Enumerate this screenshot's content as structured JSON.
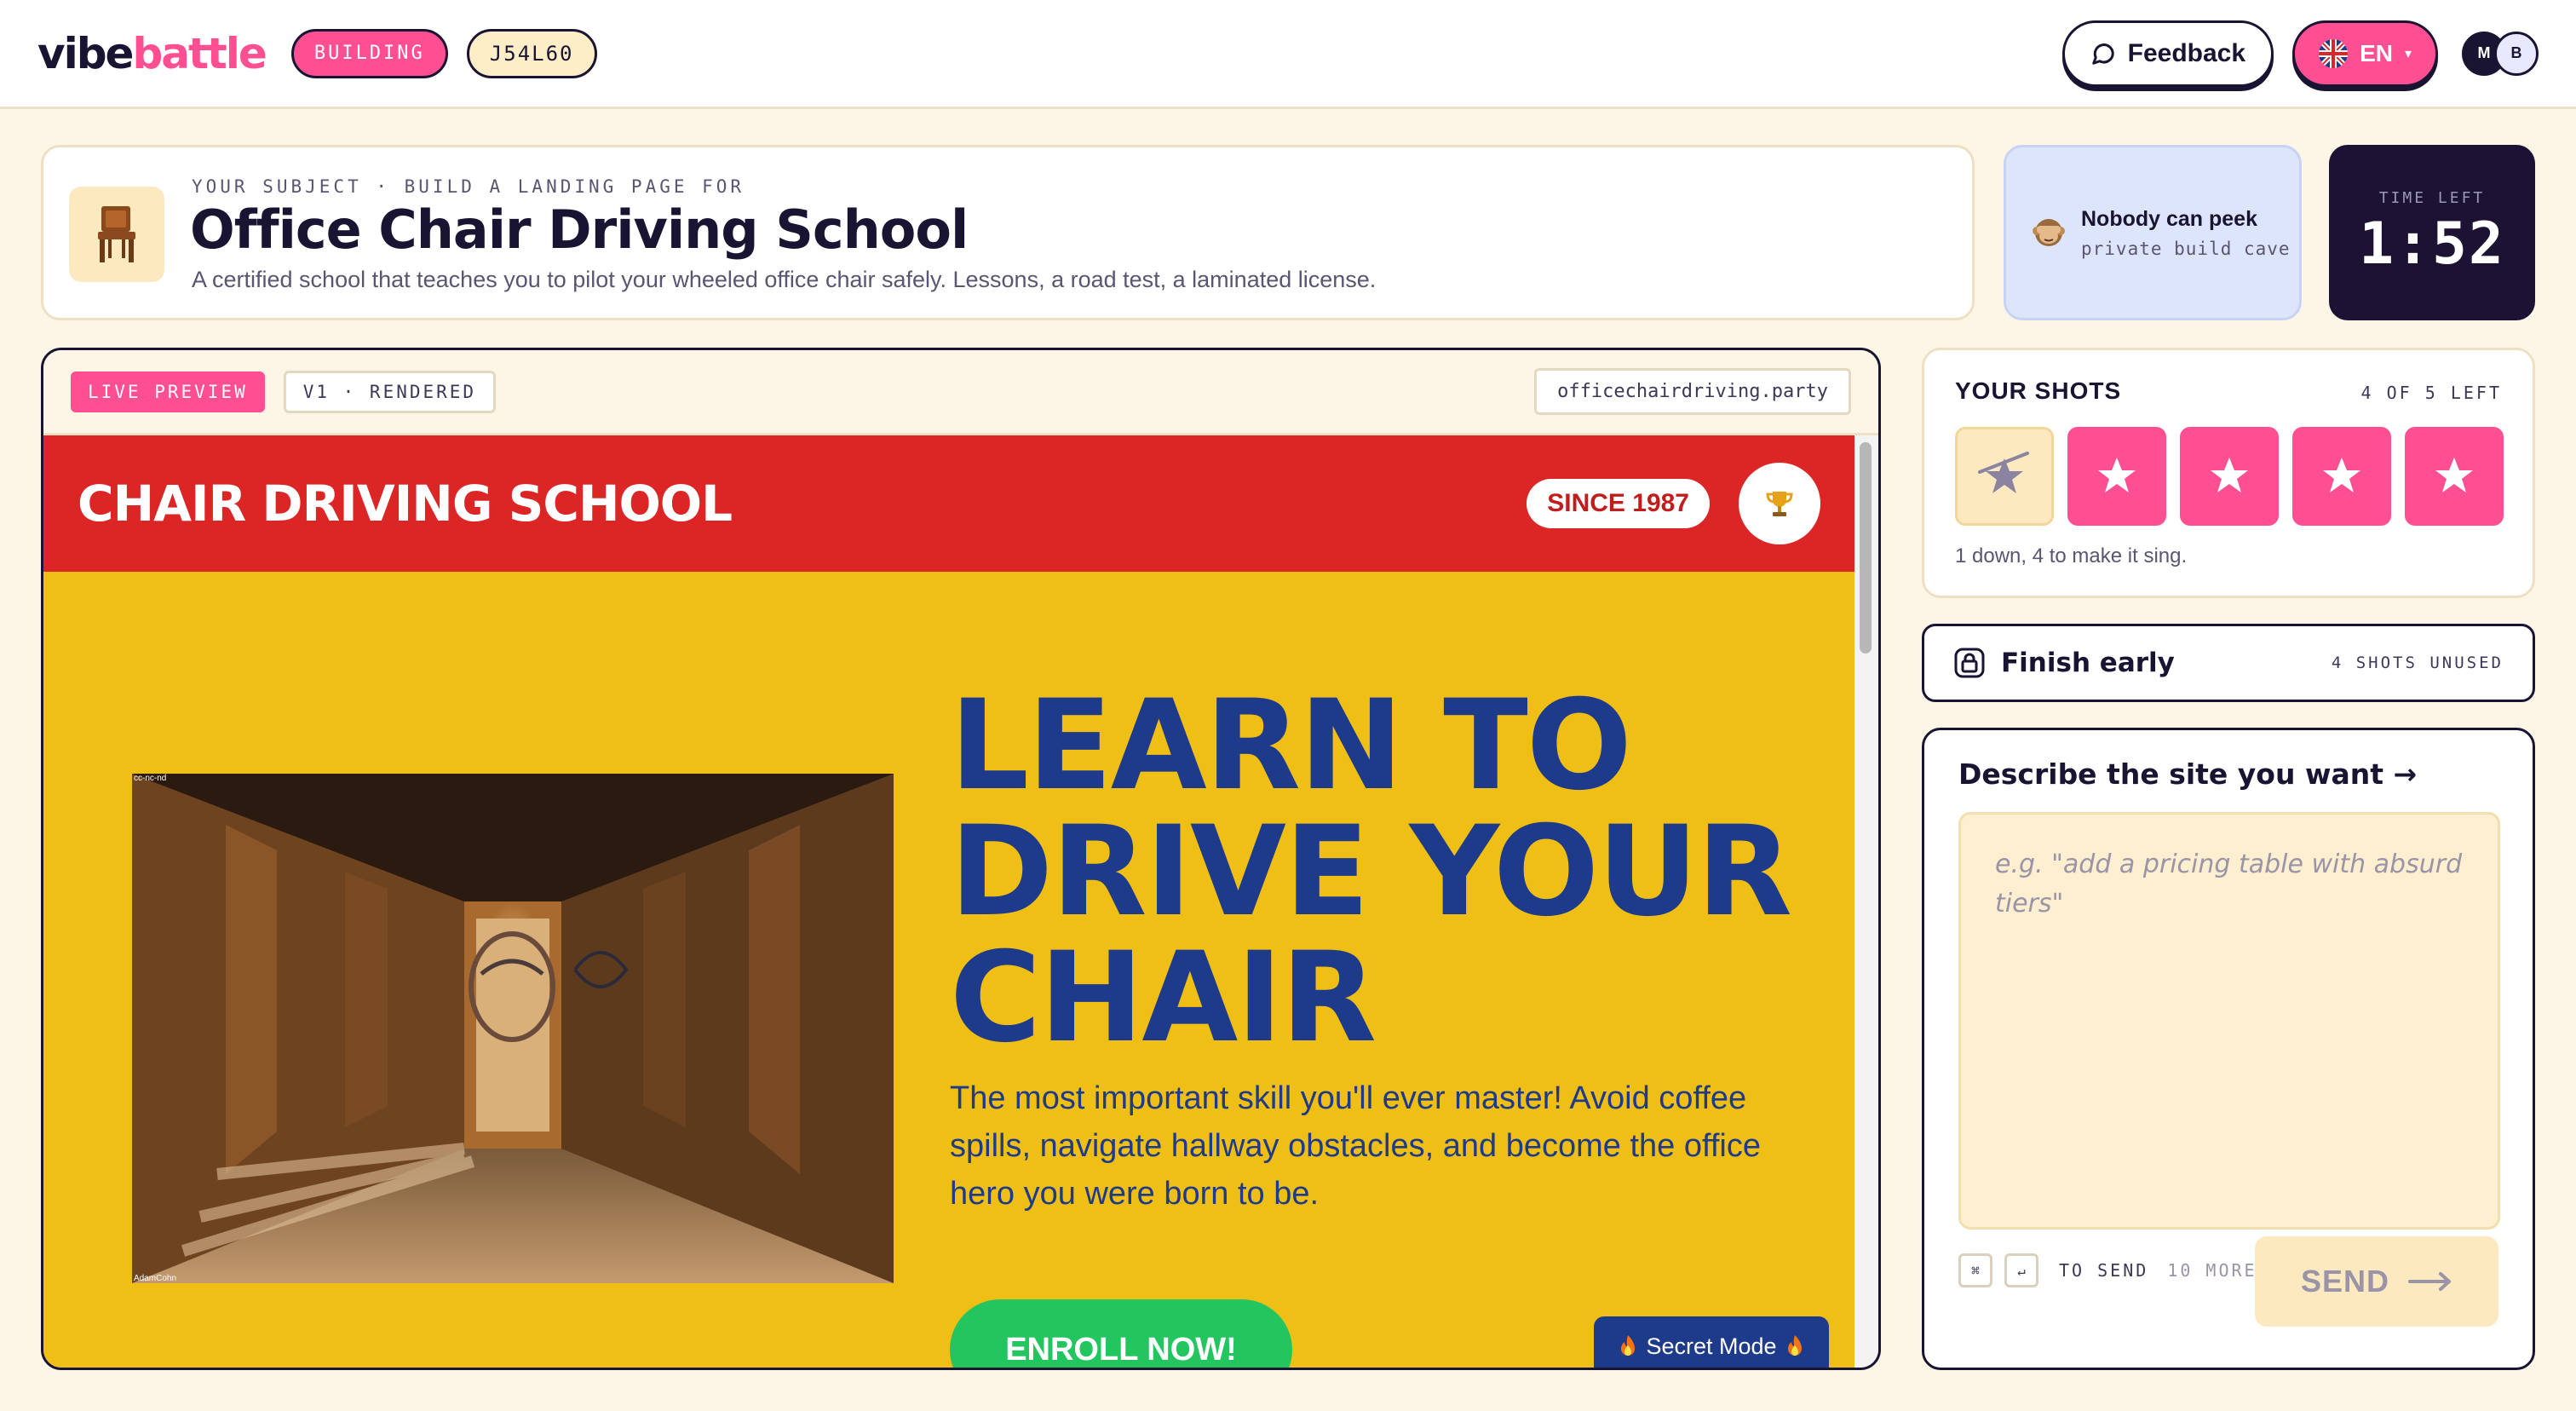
{
  "header": {
    "logo_part1": "vibe",
    "logo_part2": "battle",
    "status_badge": "BUILDING",
    "room_code": "J54L60",
    "feedback_label": "Feedback",
    "language_label": "EN",
    "language_caret": "▾",
    "avatars": [
      "M",
      "B"
    ]
  },
  "subject": {
    "kicker": "YOUR SUBJECT · BUILD A LANDING PAGE FOR",
    "title": "Office Chair Driving School",
    "description": "A certified school that teaches you to pilot your wheeled office chair safely. Lessons, a road test, a laminated license."
  },
  "privacy": {
    "title": "Nobody can peek",
    "subtitle": "private build cave"
  },
  "timer": {
    "label": "TIME LEFT",
    "value": "1:52"
  },
  "preview": {
    "live_tag": "LIVE PREVIEW",
    "version_tag": "V1 · RENDERED",
    "url": "officechairdriving.party",
    "site": {
      "brand": "CHAIR DRIVING SCHOOL",
      "since_badge": "SINCE 1987",
      "photo_license": "cc-nc-nd",
      "photo_credit": "AdamCohn",
      "headline": "LEARN TO DRIVE YOUR CHAIR",
      "lead": "The most important skill you'll ever master! Avoid coffee spills, navigate hallway obstacles, and become the office hero you were born to be.",
      "cta": "ENROLL NOW!",
      "secret_mode": "Secret Mode"
    }
  },
  "shots": {
    "title": "YOUR SHOTS",
    "remaining_label": "4 OF 5 LEFT",
    "total": 5,
    "used": 1,
    "note": "1 down, 4 to make it sing."
  },
  "finish": {
    "label": "Finish early",
    "unused_label": "4 SHOTS UNUSED"
  },
  "prompt": {
    "heading": "Describe the site you want →",
    "placeholder": "e.g. \"add a pricing table with absurd tiers\"",
    "kbd1": "⌘",
    "kbd2": "↵",
    "to_send": "TO SEND",
    "more": "10 MORE",
    "send_label": "SEND"
  },
  "colors": {
    "accent_pink": "#ff4f93",
    "dark": "#1a1433",
    "cream": "#fdf6e6",
    "site_red": "#dc2626",
    "site_yellow": "#efbf16",
    "site_blue": "#1e3a8a",
    "site_green": "#22c55e"
  }
}
